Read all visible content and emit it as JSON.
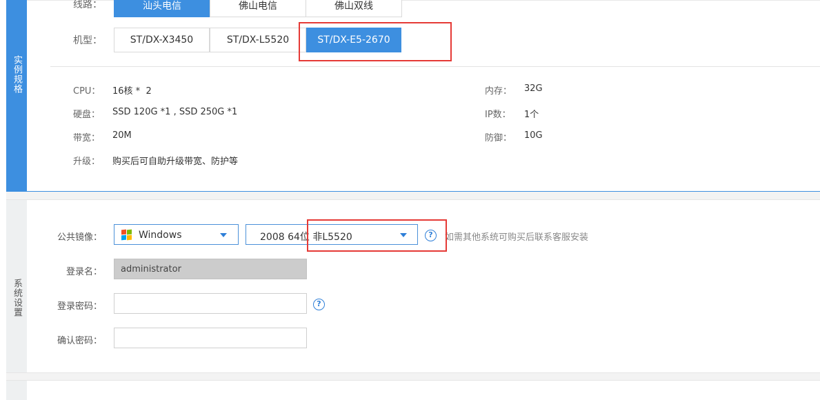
{
  "spec": {
    "sidebar_title": "实例规格",
    "line": {
      "label": "线路：",
      "options": [
        "汕头电信",
        "佛山电信",
        "佛山双线"
      ],
      "selected_index": 0
    },
    "model": {
      "label": "机型：",
      "options": [
        "ST/DX-X3450",
        "ST/DX-L5520",
        "ST/DX-E5-2670"
      ],
      "selected_index": 2
    },
    "details": {
      "cpu_label": "CPU：",
      "cpu_value": "16核 *  2",
      "memory_label": "内存：",
      "memory_value": "32G",
      "disk_label": "硬盘：",
      "disk_value": "SSD 120G *1 , SSD 250G *1",
      "ip_label": "IP数：",
      "ip_value": "1个",
      "bandwidth_label": "带宽：",
      "bandwidth_value": "20M",
      "defense_label": "防御：",
      "defense_value": "10G",
      "upgrade_label": "升级：",
      "upgrade_value": "购买后可自助升级带宽、防护等"
    }
  },
  "system": {
    "sidebar_title": "系统设置",
    "image": {
      "label": "公共镜像：",
      "os_value": "Windows",
      "version_value": "2008 64位 非L5520",
      "hint": "如需其他系统可购买后联系客服安装"
    },
    "login_name": {
      "label": "登录名：",
      "value": "administrator"
    },
    "password": {
      "label": "登录密码：",
      "value": ""
    },
    "confirm_password": {
      "label": "确认密码：",
      "value": ""
    },
    "help_glyph": "?"
  },
  "colors": {
    "accent": "#3d8fe0",
    "highlight": "#e53935"
  },
  "icons": {
    "os_logo": "windows-logo-icon",
    "help": "help-circle-icon",
    "dropdown": "caret-down-icon"
  }
}
